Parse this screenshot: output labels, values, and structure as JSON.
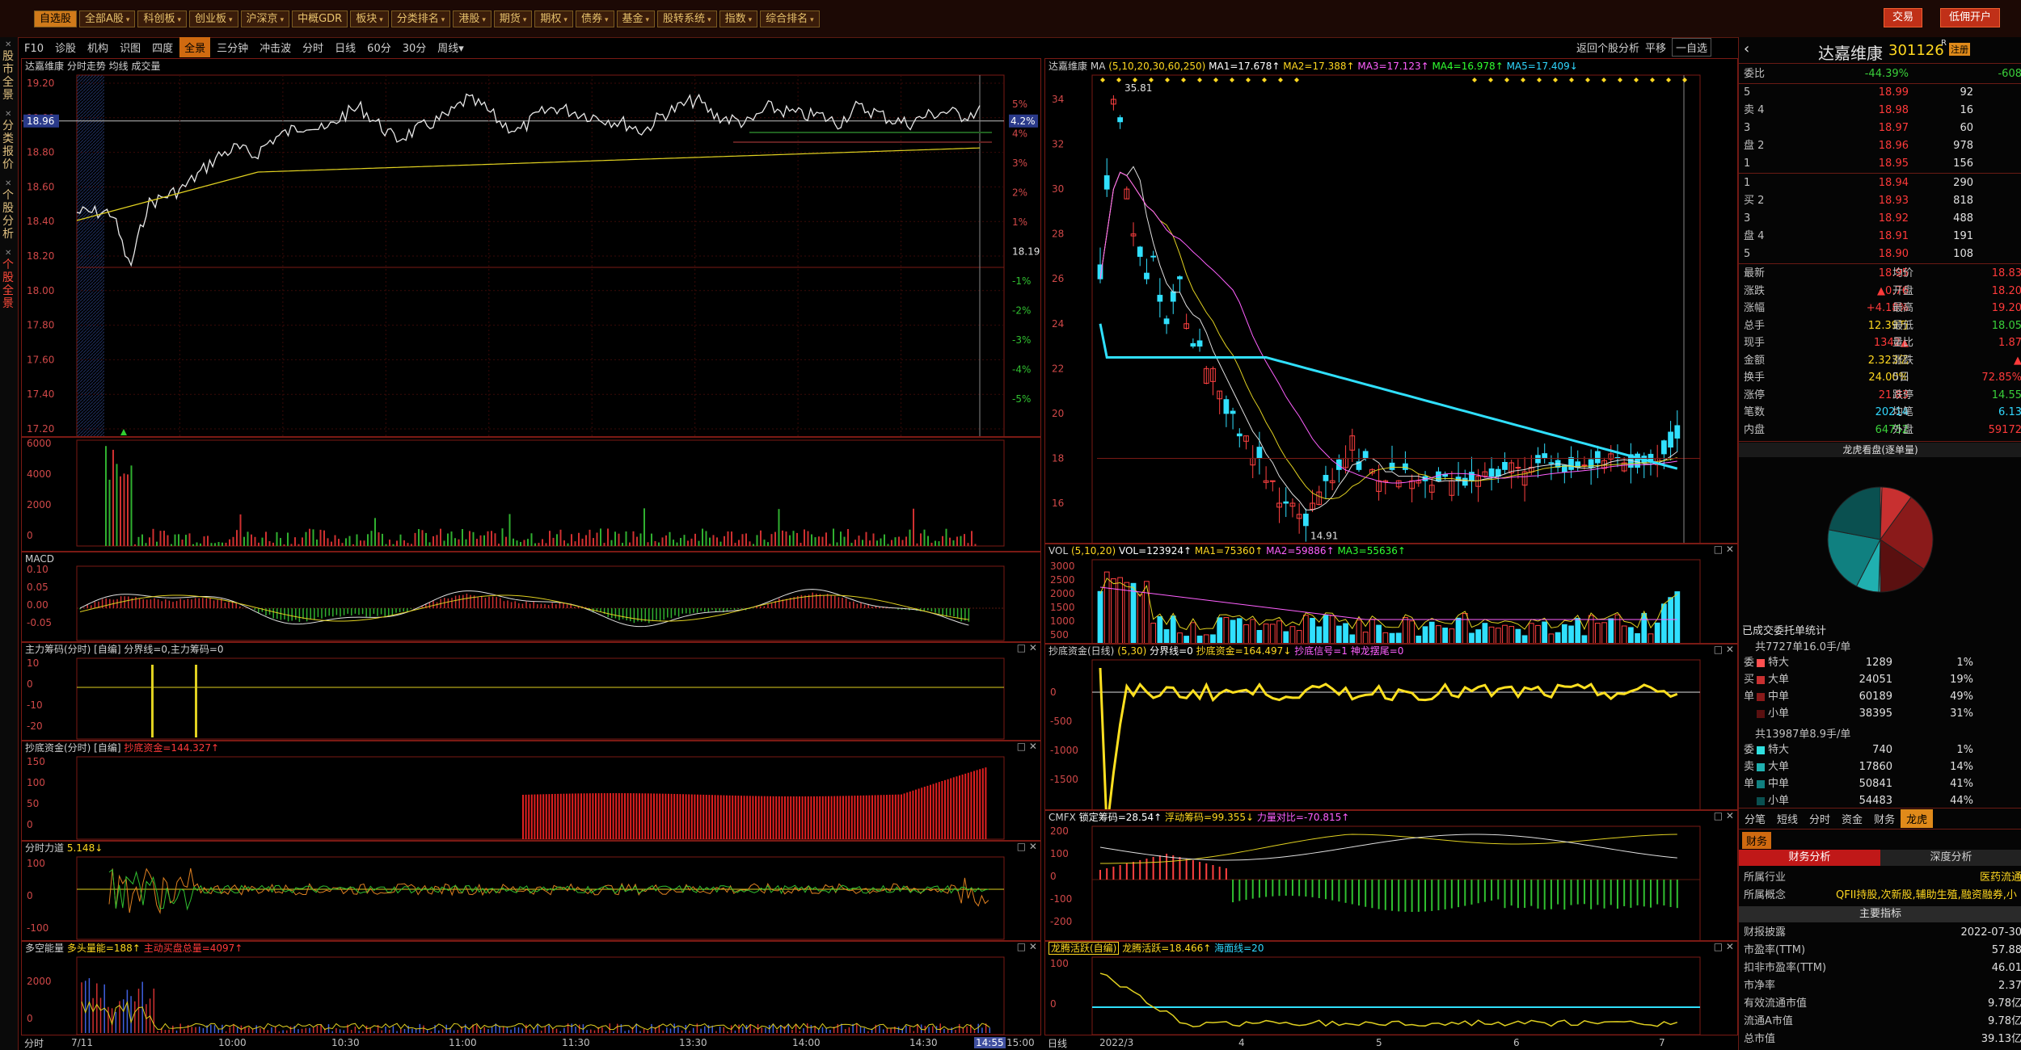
{
  "topbar": {
    "buttons": [
      {
        "label": "自选股",
        "active": true,
        "caret": false
      },
      {
        "label": "全部A股",
        "active": false,
        "caret": true
      },
      {
        "label": "科创板",
        "active": false,
        "caret": true
      },
      {
        "label": "创业板",
        "active": false,
        "caret": true
      },
      {
        "label": "沪深京",
        "active": false,
        "caret": true
      },
      {
        "label": "中概GDR",
        "active": false,
        "caret": false
      },
      {
        "label": "板块",
        "active": false,
        "caret": true
      },
      {
        "label": "分类排名",
        "active": false,
        "caret": true
      },
      {
        "label": "港股",
        "active": false,
        "caret": true
      },
      {
        "label": "期货",
        "active": false,
        "caret": true
      },
      {
        "label": "期权",
        "active": false,
        "caret": true
      },
      {
        "label": "债券",
        "active": false,
        "caret": true
      },
      {
        "label": "基金",
        "active": false,
        "caret": true
      },
      {
        "label": "股转系统",
        "active": false,
        "caret": true
      },
      {
        "label": "指数",
        "active": false,
        "caret": true
      },
      {
        "label": "综合排名",
        "active": false,
        "caret": true
      }
    ],
    "trade_btn": "交易",
    "open_btn": "低佣开户"
  },
  "leftnav": {
    "items": [
      {
        "label": "股市全景",
        "active": false
      },
      {
        "label": "分类报价",
        "active": false
      },
      {
        "label": "个股分析",
        "active": false
      },
      {
        "label": "个股全景",
        "active": true
      }
    ]
  },
  "toolbar2": {
    "items": [
      {
        "label": "F10",
        "sel": false
      },
      {
        "label": "诊股",
        "sel": false
      },
      {
        "label": "机构",
        "sel": false
      },
      {
        "label": "识图",
        "sel": false
      },
      {
        "label": "四度",
        "sel": false
      },
      {
        "label": "全景",
        "sel": true
      },
      {
        "label": "三分钟",
        "sel": false
      },
      {
        "label": "冲击波",
        "sel": false
      },
      {
        "label": "分时",
        "sel": false
      },
      {
        "label": "日线",
        "sel": false
      },
      {
        "label": "60分",
        "sel": false
      },
      {
        "label": "30分",
        "sel": false
      },
      {
        "label": "周线▾",
        "sel": false
      }
    ],
    "back": "返回个股分析",
    "flat": "平移",
    "watch": "一自选"
  },
  "intraday": {
    "header": "达嘉维康  分时走势  均线  成交量",
    "price_ticks": [
      "19.20",
      "19.00",
      "18.80",
      "18.60",
      "18.40",
      "18.20",
      "18.00",
      "17.80",
      "17.60",
      "17.40",
      "17.20"
    ],
    "pct_ticks": [
      "5%",
      "4%",
      "3%",
      "2%",
      "1%",
      "18.19",
      "-1%",
      "-2%",
      "-3%",
      "-4%",
      "-5%"
    ],
    "current_price": "18.96",
    "current_pct": "4.2%",
    "vol_ticks": [
      "6000",
      "4000",
      "2000",
      "0"
    ],
    "macd_header": "MACD",
    "macd_ticks": [
      "0.10",
      "0.05",
      "0.00",
      "-0.05"
    ],
    "zlcm_header": "主力筹码(分时)  [自编]  分界线=0,主力筹码=0",
    "zlcm_ticks": [
      "10",
      "0",
      "-10",
      "-20"
    ],
    "cdzj_header": "抄底资金(分时)  [自编]",
    "cdzj_value": "抄底资金=144.327↑",
    "cdzj_ticks": [
      "150",
      "100",
      "50",
      "0"
    ],
    "fsld_header": "分时力道",
    "fsld_value": "5.148↓",
    "fsld_ticks": [
      "100",
      "0",
      "-100"
    ],
    "dknl_header": "多空能量",
    "dknl_value1": "多头量能=188↑",
    "dknl_value2": "主动买盘总量=4097↑",
    "dknl_ticks": [
      "2000",
      "0"
    ],
    "time_axis": [
      "7/11",
      "10:00",
      "10:30",
      "11:00",
      "11:30",
      "13:30",
      "14:00",
      "14:30",
      "14:55",
      "15:00"
    ],
    "time_mode": "分时"
  },
  "daily": {
    "header_name": "达嘉维康",
    "ma_label": "MA",
    "ma_params": "(5,10,20,30,60,250)",
    "ma_values": [
      {
        "label": "MA1=17.678↑",
        "color": "#ffffff"
      },
      {
        "label": "MA2=17.388↑",
        "color": "#ffd820"
      },
      {
        "label": "MA3=17.123↑",
        "color": "#ff60ff"
      },
      {
        "label": "MA4=16.978↑",
        "color": "#30ff30"
      },
      {
        "label": "MA5=17.409↓",
        "color": "#30d8ff"
      }
    ],
    "price_ticks": [
      "34",
      "32",
      "30",
      "28",
      "26",
      "24",
      "22",
      "20",
      "18",
      "16"
    ],
    "high_label": "35.81",
    "low_label": "14.91",
    "vol_header": "VOL",
    "vol_params": "(5,10,20)",
    "vol_values": [
      {
        "label": "VOL=123924↑",
        "color": "#ffffff"
      },
      {
        "label": "MA1=75360↑",
        "color": "#ffd820"
      },
      {
        "label": "MA2=59886↑",
        "color": "#ff60ff"
      },
      {
        "label": "MA3=55636↑",
        "color": "#30ff30"
      }
    ],
    "vol_ticks": [
      "3000",
      "2500",
      "2000",
      "1500",
      "1000",
      "500"
    ],
    "cd_header": "抄底资金(日线)",
    "cd_params": "(5,30)",
    "cd_values": [
      {
        "label": "分界线=0",
        "color": "#ffffff"
      },
      {
        "label": "抄底资金=164.497↓",
        "color": "#ffd820"
      },
      {
        "label": "抄底信号=1",
        "color": "#ff60ff"
      },
      {
        "label": "神龙摆尾=0",
        "color": "#ff60ff"
      }
    ],
    "cd_ticks": [
      "0",
      "-500",
      "-1000",
      "-1500"
    ],
    "cmfx_header": "CMFX",
    "cmfx_values": [
      {
        "label": "锁定筹码=28.54↑",
        "color": "#ffffff"
      },
      {
        "label": "浮动筹码=99.355↓",
        "color": "#ffd820"
      },
      {
        "label": "力量对比=-70.815↑",
        "color": "#ff60ff"
      }
    ],
    "cmfx_ticks": [
      "200",
      "100",
      "0",
      "-100",
      "-200"
    ],
    "ltj_header": "龙腾活跃(自编)",
    "ltj_values": [
      {
        "label": "龙腾活跃=18.466↑",
        "color": "#ffd820"
      },
      {
        "label": "海面线=20",
        "color": "#30d8ff"
      }
    ],
    "ltj_ticks": [
      "100",
      "0"
    ],
    "time_axis": [
      "2022/3",
      "4",
      "5",
      "6",
      "7"
    ],
    "time_mode": "日线"
  },
  "quote": {
    "name": "达嘉维康",
    "code": "301126",
    "r": "R",
    "reg": "注册",
    "weibi_label": "委比",
    "weibi": "-44.39%",
    "weicha": "-608",
    "sell": [
      {
        "label": "5",
        "price": "18.99",
        "vol": "92"
      },
      {
        "label": "4",
        "price": "18.98",
        "vol": "16"
      },
      {
        "label": "3",
        "price": "18.97",
        "vol": "60"
      },
      {
        "label": "2",
        "price": "18.96",
        "vol": "978"
      },
      {
        "label": "1",
        "price": "18.95",
        "vol": "156"
      }
    ],
    "buy": [
      {
        "label": "1",
        "price": "18.94",
        "vol": "290"
      },
      {
        "label": "2",
        "price": "18.93",
        "vol": "818"
      },
      {
        "label": "3",
        "price": "18.92",
        "vol": "488"
      },
      {
        "label": "4",
        "price": "18.91",
        "vol": "191"
      },
      {
        "label": "5",
        "price": "18.90",
        "vol": "108"
      }
    ],
    "side_sell": [
      "卖",
      "盘"
    ],
    "side_buy": [
      "买",
      "盘"
    ],
    "stats": [
      {
        "l1": "最新",
        "v1": "18.95",
        "c1": "red",
        "l2": "均价",
        "v2": "18.83",
        "c2": "red"
      },
      {
        "l1": "涨跌",
        "v1": "▲0.76",
        "c1": "red",
        "l2": "开盘",
        "v2": "18.20",
        "c2": "red"
      },
      {
        "l1": "涨幅",
        "v1": "+4.18%",
        "c1": "red",
        "l2": "最高",
        "v2": "19.20",
        "c2": "red"
      },
      {
        "l1": "总手",
        "v1": "12.39万",
        "c1": "yel",
        "l2": "最低",
        "v2": "18.05",
        "c2": "grn"
      },
      {
        "l1": "现手",
        "v1": "1342▲",
        "c1": "red",
        "l2": "量比",
        "v2": "1.87",
        "c2": "red"
      },
      {
        "l1": "金额",
        "v1": "2.323亿",
        "c1": "yel",
        "l2": "涨跌",
        "v2": "▲",
        "c2": "red"
      },
      {
        "l1": "换手",
        "v1": "24.00%",
        "c1": "yel",
        "l2": "5日",
        "v2": "72.85%",
        "c2": "red"
      },
      {
        "l1": "涨停",
        "v1": "21.83",
        "c1": "red",
        "l2": "跌停",
        "v2": "14.55",
        "c2": "grn"
      },
      {
        "l1": "笔数",
        "v1": "20214",
        "c1": "cyan",
        "l2": "均笔",
        "v2": "6.13",
        "c2": "cyan"
      },
      {
        "l1": "内盘",
        "v1": "64752",
        "c1": "grn",
        "l2": "外盘",
        "v2": "59172",
        "c2": "red"
      }
    ],
    "pie_title": "龙虎看盘(逐单量)",
    "pie": [
      {
        "name": "特大买",
        "value": 1,
        "color": "#ff5050"
      },
      {
        "name": "大单买",
        "value": 19,
        "color": "#c83030"
      },
      {
        "name": "中单买",
        "value": 49,
        "color": "#8a1a1a"
      },
      {
        "name": "小单买",
        "value": 31,
        "color": "#5a1010"
      },
      {
        "name": "特大卖",
        "value": 1,
        "color": "#30e0e0"
      },
      {
        "name": "大单卖",
        "value": 14,
        "color": "#20b0b0"
      },
      {
        "name": "中单卖",
        "value": 41,
        "color": "#108080"
      },
      {
        "name": "小单卖",
        "value": 44,
        "color": "#0a5050"
      }
    ],
    "order_title": "已成交委托单统计",
    "buy_summary": "共7727单16.0手/单",
    "buy_side": "委买单",
    "buy_rows": [
      {
        "name": "特大",
        "vol": "1289",
        "pct": "1%",
        "color": "#ff5050"
      },
      {
        "name": "大单",
        "vol": "24051",
        "pct": "19%",
        "color": "#c83030"
      },
      {
        "name": "中单",
        "vol": "60189",
        "pct": "49%",
        "color": "#8a1a1a"
      },
      {
        "name": "小单",
        "vol": "38395",
        "pct": "31%",
        "color": "#5a1010"
      }
    ],
    "sell_summary": "共13987单8.9手/单",
    "sell_side": "委卖单",
    "sell_rows": [
      {
        "name": "特大",
        "vol": "740",
        "pct": "1%",
        "color": "#30e0e0"
      },
      {
        "name": "大单",
        "vol": "17860",
        "pct": "14%",
        "color": "#20b0b0"
      },
      {
        "name": "中单",
        "vol": "50841",
        "pct": "41%",
        "color": "#108080"
      },
      {
        "name": "小单",
        "vol": "54483",
        "pct": "44%",
        "color": "#0a5050"
      }
    ],
    "subtabs": [
      {
        "label": "分笔",
        "sel": false
      },
      {
        "label": "短线",
        "sel": false
      },
      {
        "label": "分时",
        "sel": false
      },
      {
        "label": "资金",
        "sel": false
      },
      {
        "label": "财务",
        "sel": false
      },
      {
        "label": "龙虎",
        "sel": true
      }
    ],
    "fin_tab": "财务",
    "fin_analysis": "财务分析",
    "deep_analysis": "深度分析",
    "industry_label": "所属行业",
    "industry": "医药流通",
    "concept_label": "所属概念",
    "concept": "QFII持股,次新股,辅助生殖,融资融券,小",
    "main_index": "主要指标",
    "fin_rows": [
      {
        "l": "财报披露",
        "v": "2022-07-30"
      },
      {
        "l": "市盈率(TTM)",
        "v": "57.88"
      },
      {
        "l": "扣非市盈率(TTM)",
        "v": "46.01"
      },
      {
        "l": "市净率",
        "v": "2.37"
      },
      {
        "l": "有效流通市值",
        "v": "9.78亿"
      },
      {
        "l": "流通A市值",
        "v": "9.78亿"
      },
      {
        "l": "总市值",
        "v": "39.13亿"
      }
    ]
  }
}
